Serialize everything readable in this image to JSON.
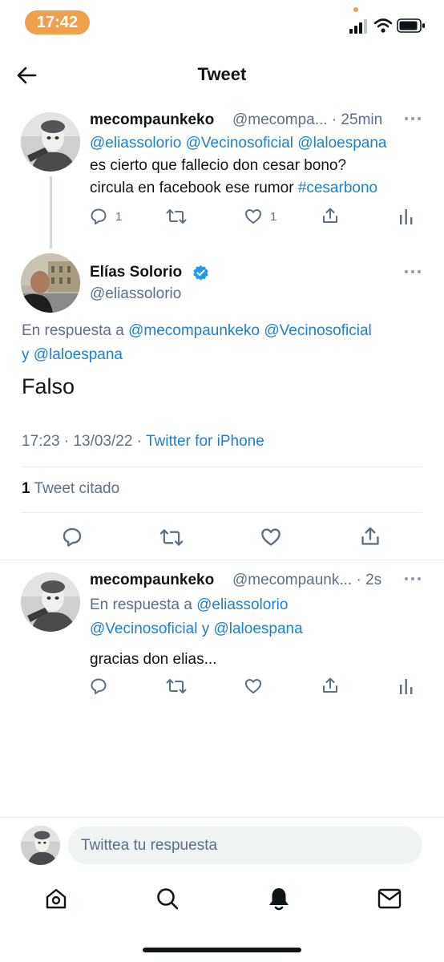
{
  "status_bar": {
    "time": "17:42"
  },
  "header": {
    "title": "Tweet"
  },
  "tweet1": {
    "name": "mecompaunkeko",
    "handle_time": "@mecompa... · 25min",
    "mentions": "@eliassolorio @Vecinosoficial @laloespana",
    "text_line1": "es cierto que fallecio don cesar bono?",
    "text_line2": "circula en facebook ese rumor ",
    "hashtag": "#cesarbono",
    "reply_count": "1",
    "like_count": "1"
  },
  "main_tweet": {
    "name": "Elías Solorio",
    "handle": "@eliassolorio",
    "reply_prefix": "En respuesta a ",
    "reply_line1_mentions": "@mecompaunkeko @Vecinosoficial",
    "reply_line2_and": "y ",
    "reply_line2_mention": "@laloespana",
    "text": "Falso",
    "timestamp": "17:23 · 13/03/22 · ",
    "source": "Twitter for iPhone",
    "quote_count": "1",
    "quote_label": " Tweet citado"
  },
  "reply_tweet": {
    "name": "mecompaunkeko",
    "handle_time": "@mecompaunk... · 2s",
    "reply_prefix": "En respuesta a ",
    "reply_mention1": "@eliassolorio",
    "reply_mention2": "@Vecinosoficial",
    "reply_and": " y ",
    "reply_mention3": "@laloespana",
    "text": "gracias don elias..."
  },
  "compose": {
    "placeholder": "Twittea tu respuesta"
  },
  "colors": {
    "accent": "#1d7fcf",
    "status_pill": "#f0a04b",
    "muted": "#5b7083"
  },
  "icons": [
    "back-arrow-icon",
    "reply-icon",
    "retweet-icon",
    "like-icon",
    "share-icon",
    "analytics-icon",
    "more-icon",
    "verified-icon",
    "home-icon",
    "search-icon",
    "notifications-icon",
    "messages-icon"
  ]
}
